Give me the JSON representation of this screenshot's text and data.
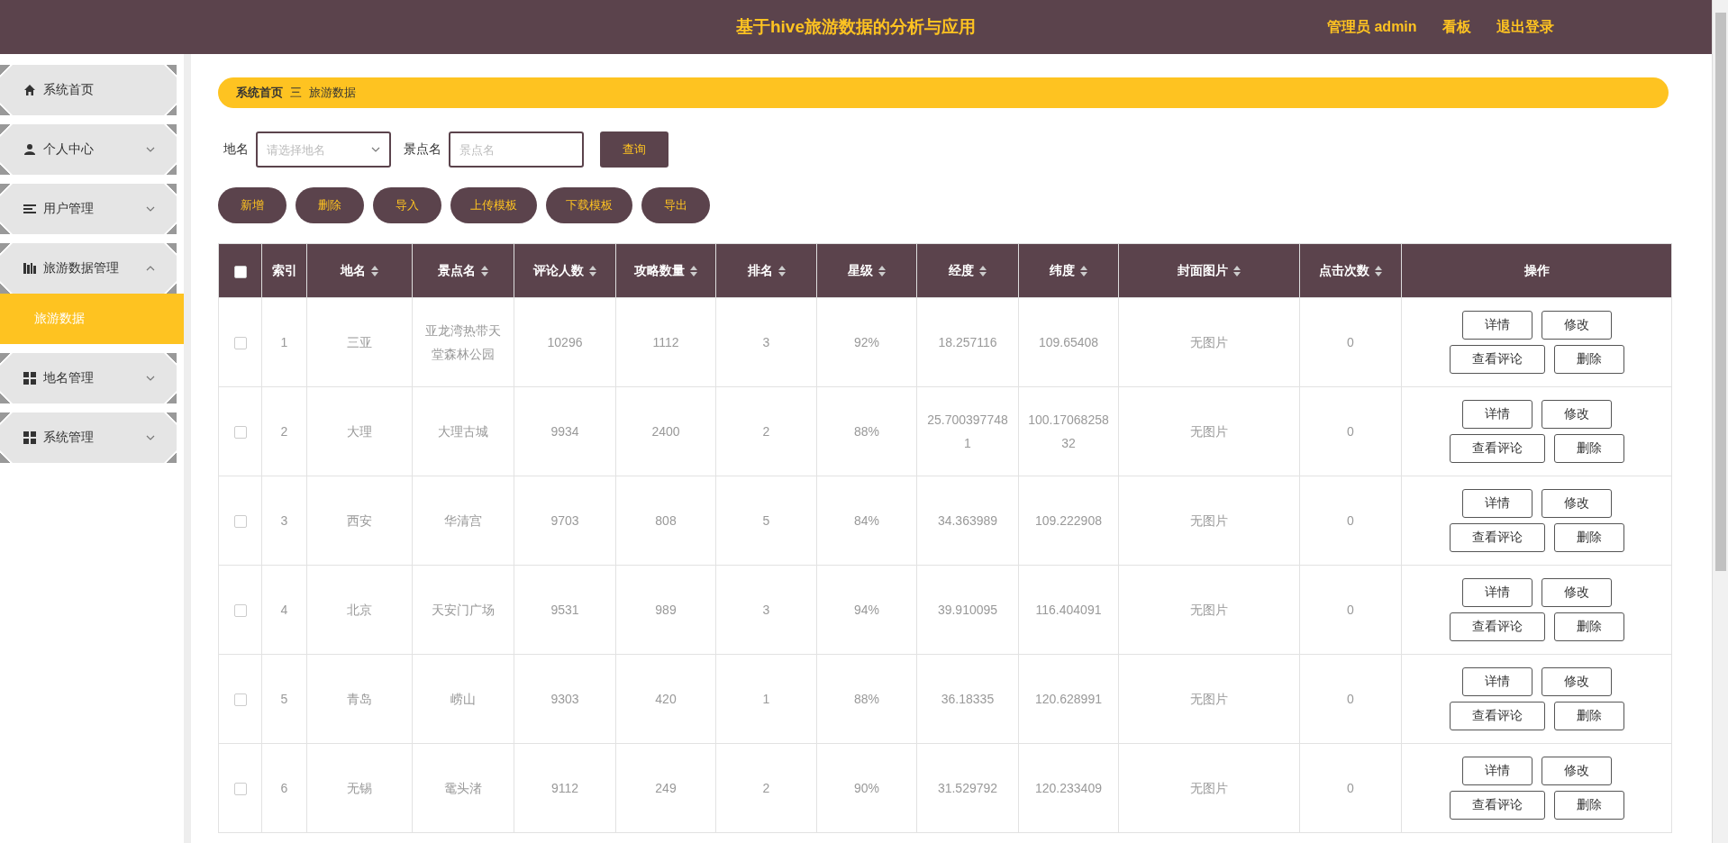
{
  "header": {
    "title": "基于hive旅游数据的分析与应用",
    "user": "管理员 admin",
    "links": [
      "看板",
      "退出登录"
    ]
  },
  "sidebar": {
    "items": [
      {
        "label": "系统首页",
        "kind": "link"
      },
      {
        "label": "个人中心",
        "kind": "menu",
        "expanded": false
      },
      {
        "label": "用户管理",
        "kind": "menu",
        "expanded": false
      },
      {
        "label": "旅游数据管理",
        "kind": "menu",
        "expanded": true,
        "children": [
          {
            "label": "旅游数据",
            "selected": true
          }
        ]
      },
      {
        "label": "地名管理",
        "kind": "menu",
        "expanded": false
      },
      {
        "label": "系统管理",
        "kind": "menu",
        "expanded": false
      }
    ]
  },
  "breadcrumb": {
    "items": [
      "系统首页",
      "旅游数据"
    ],
    "separator": "三"
  },
  "search": {
    "fields": [
      {
        "label": "地名",
        "kind": "select",
        "placeholder": "请选择地名"
      },
      {
        "label": "景点名",
        "kind": "text",
        "placeholder": "景点名"
      }
    ],
    "button": "查询"
  },
  "actions": [
    "新增",
    "删除",
    "导入",
    "上传模板",
    "下载模板",
    "导出"
  ],
  "table": {
    "select_all_checked": false,
    "columns": [
      {
        "label": "索引",
        "sortable": false
      },
      {
        "label": "地名",
        "sortable": true
      },
      {
        "label": "景点名",
        "sortable": true
      },
      {
        "label": "评论人数",
        "sortable": true
      },
      {
        "label": "攻略数量",
        "sortable": true
      },
      {
        "label": "排名",
        "sortable": true
      },
      {
        "label": "星级",
        "sortable": true
      },
      {
        "label": "经度",
        "sortable": true
      },
      {
        "label": "纬度",
        "sortable": true
      },
      {
        "label": "封面图片",
        "sortable": true
      },
      {
        "label": "点击次数",
        "sortable": true
      },
      {
        "label": "操作",
        "sortable": false
      }
    ],
    "rows": [
      {
        "checked": false,
        "cells": [
          "1",
          "三亚",
          "亚龙湾热带天堂森林公园",
          "10296",
          "1112",
          "3",
          "92%",
          "18.257116",
          "109.65408",
          "无图片",
          "0"
        ],
        "actions": [
          "详情",
          "修改",
          "查看评论",
          "删除"
        ]
      },
      {
        "checked": false,
        "cells": [
          "2",
          "大理",
          "大理古城",
          "9934",
          "2400",
          "2",
          "88%",
          "25.7003977481",
          "100.1706825832",
          "无图片",
          "0"
        ],
        "actions": [
          "详情",
          "修改",
          "查看评论",
          "删除"
        ]
      },
      {
        "checked": false,
        "cells": [
          "3",
          "西安",
          "华清宫",
          "9703",
          "808",
          "5",
          "84%",
          "34.363989",
          "109.222908",
          "无图片",
          "0"
        ],
        "actions": [
          "详情",
          "修改",
          "查看评论",
          "删除"
        ]
      },
      {
        "checked": false,
        "cells": [
          "4",
          "北京",
          "天安门广场",
          "9531",
          "989",
          "3",
          "94%",
          "39.910095",
          "116.404091",
          "无图片",
          "0"
        ],
        "actions": [
          "详情",
          "修改",
          "查看评论",
          "删除"
        ]
      },
      {
        "checked": false,
        "cells": [
          "5",
          "青岛",
          "崂山",
          "9303",
          "420",
          "1",
          "88%",
          "36.18335",
          "120.628991",
          "无图片",
          "0"
        ],
        "actions": [
          "详情",
          "修改",
          "查看评论",
          "删除"
        ]
      },
      {
        "checked": false,
        "cells": [
          "6",
          "无锡",
          "鼋头渚",
          "9112",
          "249",
          "2",
          "90%",
          "31.529792",
          "120.233409",
          "无图片",
          "0"
        ],
        "actions": [
          "详情",
          "修改",
          "查看评论",
          "删除"
        ]
      }
    ]
  }
}
